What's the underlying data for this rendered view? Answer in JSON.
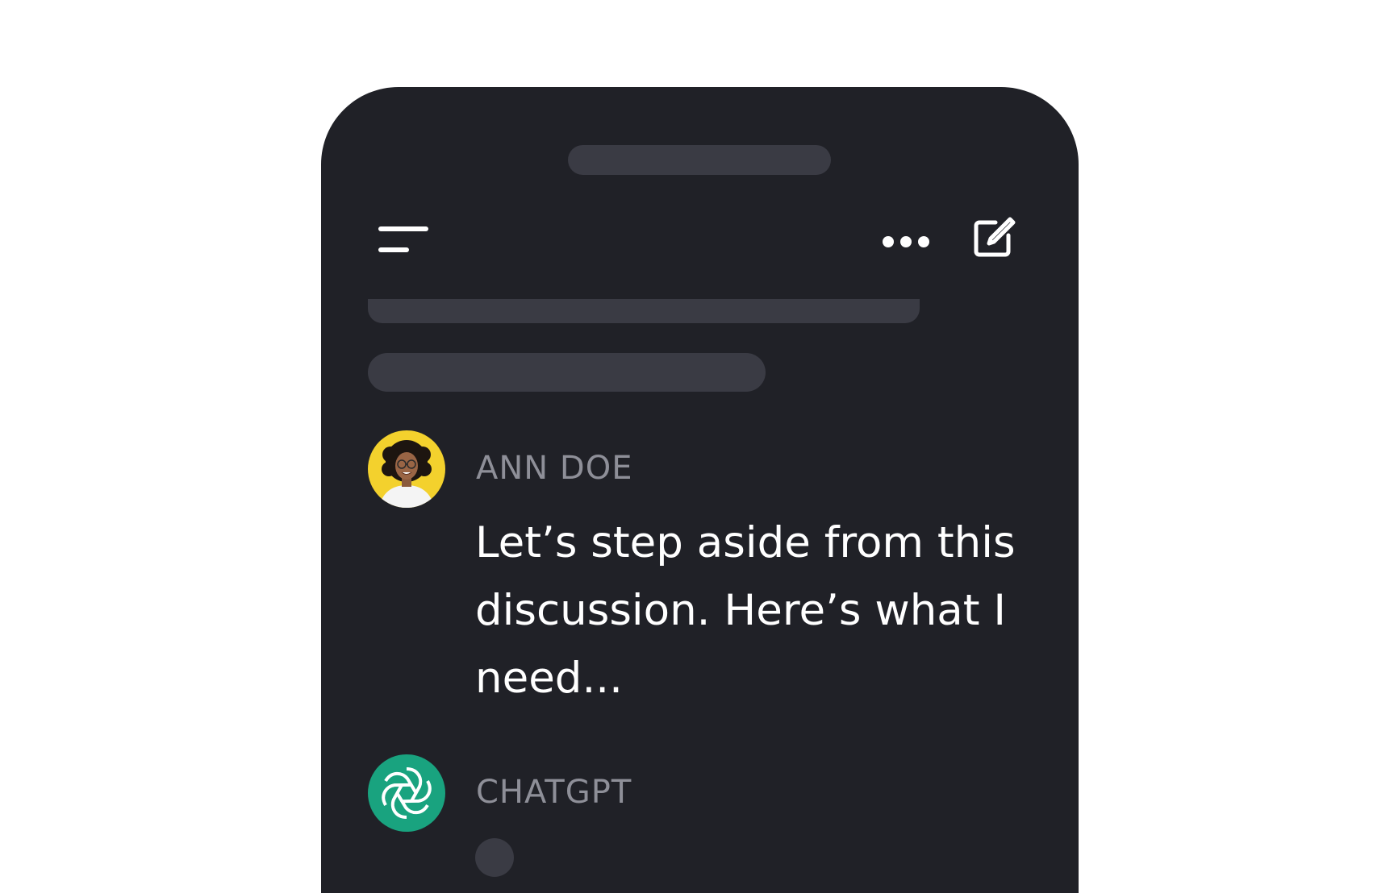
{
  "header": {
    "menu_icon": "menu-icon",
    "more_icon": "more-horizontal-icon",
    "compose_icon": "compose-icon"
  },
  "messages": [
    {
      "sender": "ANN DOE",
      "avatar": "user-avatar",
      "text": "Let’s step aside from this discussion. Here’s what I need..."
    },
    {
      "sender": "CHATGPT",
      "avatar": "chatgpt-logo-icon",
      "status": "typing"
    }
  ],
  "colors": {
    "background": "#ffffff",
    "phone": "#202127",
    "skeleton": "#3a3b44",
    "sender_label": "#8e8f98",
    "message_text": "#ffffff",
    "ann_avatar_bg": "#f3d12d",
    "chatgpt_brand": "#19a37f"
  }
}
